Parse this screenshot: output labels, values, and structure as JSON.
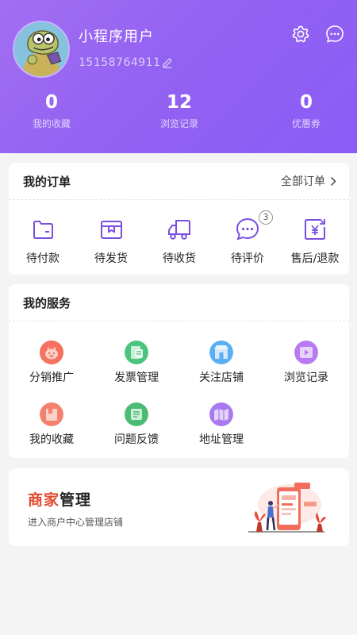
{
  "profile": {
    "username": "小程序用户",
    "phone": "15158764911",
    "avatar_icon": "cartoon-crocodile-avatar",
    "icons": {
      "edit": "pencil-icon",
      "settings": "gear-icon",
      "message": "chat-bubble-icon"
    }
  },
  "stats": [
    {
      "value": "0",
      "label": "我的收藏"
    },
    {
      "value": "12",
      "label": "浏览记录"
    },
    {
      "value": "0",
      "label": "优惠券"
    }
  ],
  "orders": {
    "title": "我的订单",
    "view_all": "全部订单",
    "items": [
      {
        "label": "待付款",
        "icon": "wallet-icon"
      },
      {
        "label": "待发货",
        "icon": "box-icon"
      },
      {
        "label": "待收货",
        "icon": "truck-icon"
      },
      {
        "label": "待评价",
        "icon": "comment-icon",
        "badge": "3"
      },
      {
        "label": "售后/退款",
        "icon": "refund-icon"
      }
    ]
  },
  "services": {
    "title": "我的服务",
    "items": [
      {
        "label": "分销推广",
        "icon": "piggy-icon",
        "color": "#f0604c"
      },
      {
        "label": "发票管理",
        "icon": "invoice-icon",
        "color": "#3fbf74"
      },
      {
        "label": "关注店铺",
        "icon": "store-icon",
        "color": "#4aa3ef"
      },
      {
        "label": "浏览记录",
        "icon": "video-icon",
        "color": "#b06af0"
      },
      {
        "label": "我的收藏",
        "icon": "favorite-icon",
        "color": "#f36b5a"
      },
      {
        "label": "问题反馈",
        "icon": "feedback-icon",
        "color": "#3fb36a"
      },
      {
        "label": "地址管理",
        "icon": "map-icon",
        "color": "#a070ee"
      }
    ]
  },
  "merchant": {
    "title_accent": "商家",
    "title_rest": "管理",
    "subtitle": "进入商户中心管理店铺",
    "illustration": "merchant-phone-illustration"
  },
  "colors": {
    "header_gradient_start": "#a26ef2",
    "header_gradient_end": "#8b5cf6",
    "accent_purple": "#8a5cf0",
    "merchant_red": "#e34a2f"
  }
}
